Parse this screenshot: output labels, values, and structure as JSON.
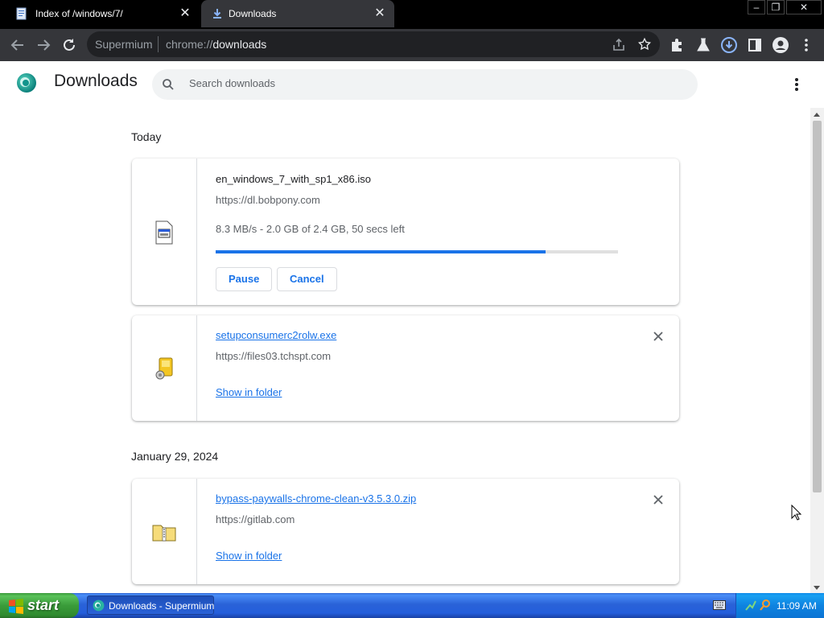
{
  "tabs": [
    {
      "title": "Index of /windows/7/",
      "active": false
    },
    {
      "title": "Downloads",
      "active": true
    }
  ],
  "window_controls": {
    "minimize": "–",
    "restore": "❐",
    "close": "✕"
  },
  "omnibox": {
    "origin": "Supermium",
    "url_scheme": "chrome://",
    "url_host": "downloads"
  },
  "header": {
    "title": "Downloads",
    "search_placeholder": "Search downloads"
  },
  "sections": [
    {
      "date": "Today",
      "items": [
        {
          "filename": "en_windows_7_with_sp1_x86.iso",
          "url": "https://dl.bobpony.com",
          "status": "8.3 MB/s - 2.0 GB of 2.4 GB, 50 secs left",
          "progress": 0.82,
          "actions": [
            "Pause",
            "Cancel"
          ],
          "icon": "iso-file-icon"
        },
        {
          "filename": "setupconsumerc2rolw.exe",
          "url": "https://files03.tchspt.com",
          "show_in_folder": "Show in folder",
          "icon": "installer-icon"
        }
      ]
    },
    {
      "date": "January 29, 2024",
      "items": [
        {
          "filename": "bypass-paywalls-chrome-clean-v3.5.3.0.zip",
          "url": "https://gitlab.com",
          "show_in_folder": "Show in folder",
          "icon": "zip-folder-icon"
        }
      ]
    }
  ],
  "taskbar": {
    "start": "start",
    "task_label": "Downloads - Supermium",
    "clock": "11:09 AM"
  },
  "colors": {
    "accent": "#1a73e8",
    "tab_bg": "#35363a",
    "toolbar_bg": "#35363a",
    "omnibox_bg": "#202124"
  }
}
